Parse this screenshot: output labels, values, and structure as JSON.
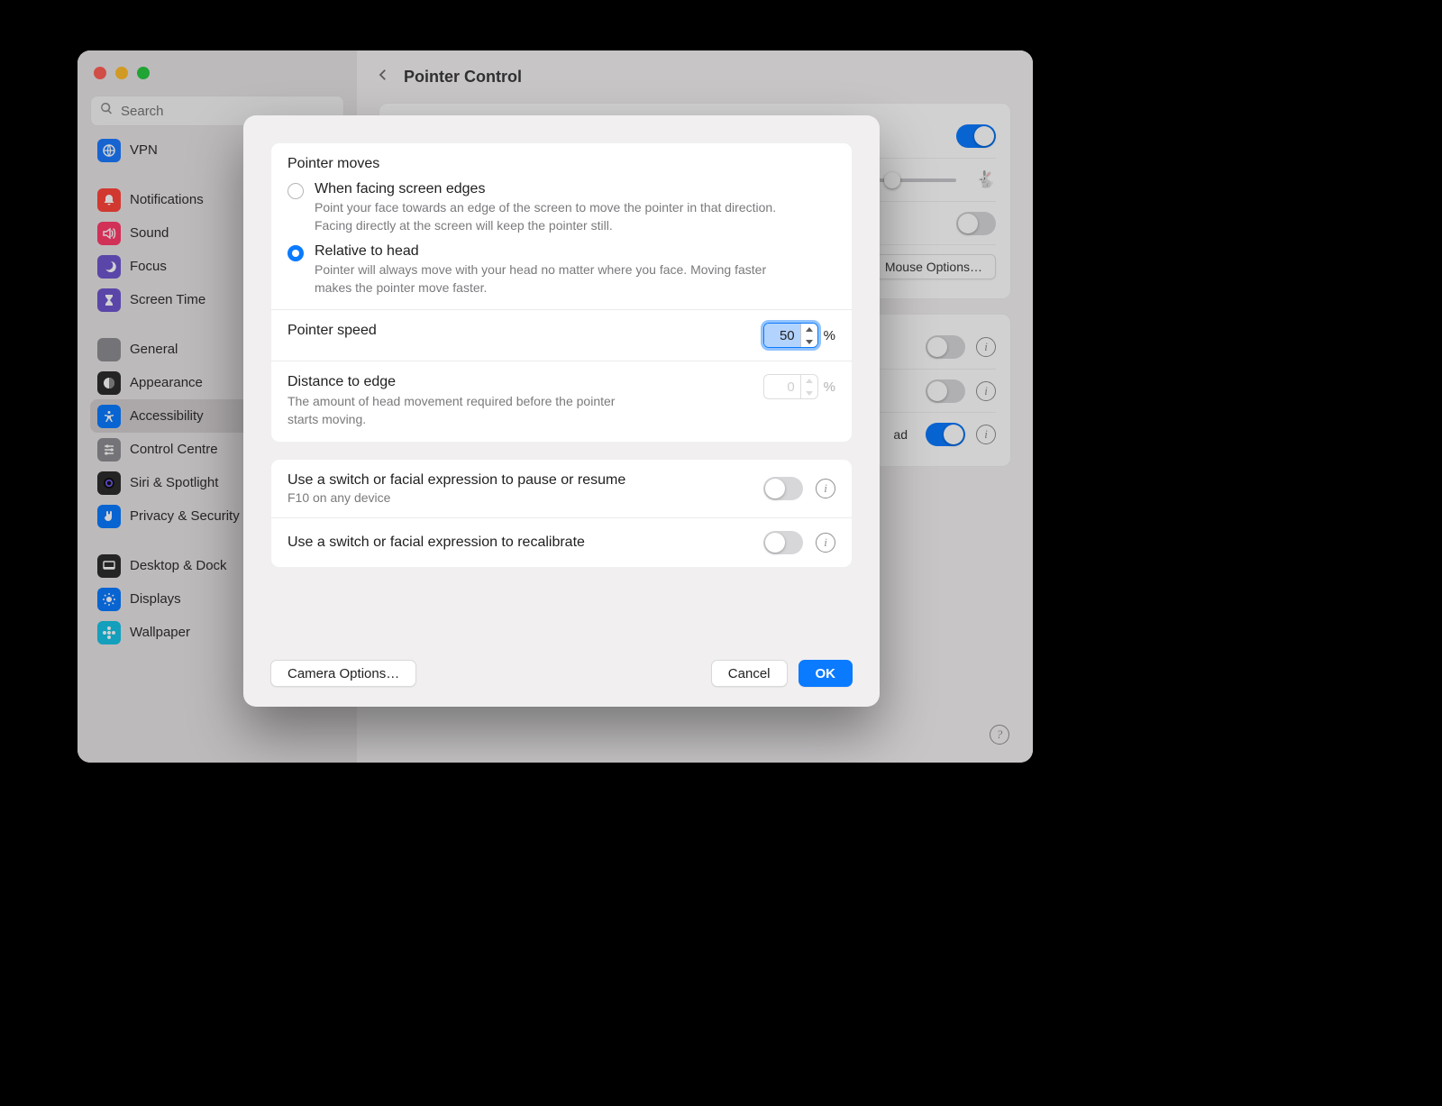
{
  "window": {
    "title": "Pointer Control",
    "search_placeholder": "Search",
    "mouse_options_label": "Mouse Options…",
    "partial_text": "ad"
  },
  "sidebar": {
    "items": [
      {
        "label": "VPN",
        "icon": "globe-icon",
        "color": "#1d7bff"
      },
      {
        "gap": true
      },
      {
        "label": "Notifications",
        "icon": "bell-icon",
        "color": "#ff453a"
      },
      {
        "label": "Sound",
        "icon": "speaker-icon",
        "color": "#ff3b6b"
      },
      {
        "label": "Focus",
        "icon": "moon-icon",
        "color": "#6e56cf"
      },
      {
        "label": "Screen Time",
        "icon": "hourglass-icon",
        "color": "#6e56cf"
      },
      {
        "gap": true
      },
      {
        "label": "General",
        "icon": "gear-icon",
        "color": "#8e8e93"
      },
      {
        "label": "Appearance",
        "icon": "appearance-icon",
        "color": "#2c2c2e"
      },
      {
        "label": "Accessibility",
        "icon": "accessibility-icon",
        "color": "#0a7aff",
        "selected": true
      },
      {
        "label": "Control Centre",
        "icon": "sliders-icon",
        "color": "#8e8e93"
      },
      {
        "label": "Siri & Spotlight",
        "icon": "siri-icon",
        "color": "#2c2c2e"
      },
      {
        "label": "Privacy & Security",
        "icon": "hand-icon",
        "color": "#0a7aff"
      },
      {
        "gap": true
      },
      {
        "label": "Desktop & Dock",
        "icon": "desktop-icon",
        "color": "#2c2c2e"
      },
      {
        "label": "Displays",
        "icon": "sun-icon",
        "color": "#0a7aff"
      },
      {
        "label": "Wallpaper",
        "icon": "flower-icon",
        "color": "#19c2e6"
      }
    ]
  },
  "sheet": {
    "section_title": "Pointer moves",
    "option_a": {
      "label": "When facing screen edges",
      "desc": "Point your face towards an edge of the screen to move the pointer in that direction. Facing directly at the screen will keep the pointer still."
    },
    "option_b": {
      "label": "Relative to head",
      "desc": "Pointer will always move with your head no matter where you face. Moving faster makes the pointer move faster."
    },
    "pointer_speed": {
      "label": "Pointer speed",
      "value": "50",
      "unit": "%"
    },
    "distance": {
      "label": "Distance to edge",
      "desc": "The amount of head movement required before the pointer starts moving.",
      "value": "0",
      "unit": "%"
    },
    "switch_pause": {
      "label": "Use a switch or facial expression to pause or resume",
      "sub": "F10 on any device"
    },
    "switch_recal": {
      "label": "Use a switch or facial expression to recalibrate"
    },
    "camera_options": "Camera Options…",
    "cancel": "Cancel",
    "ok": "OK"
  }
}
